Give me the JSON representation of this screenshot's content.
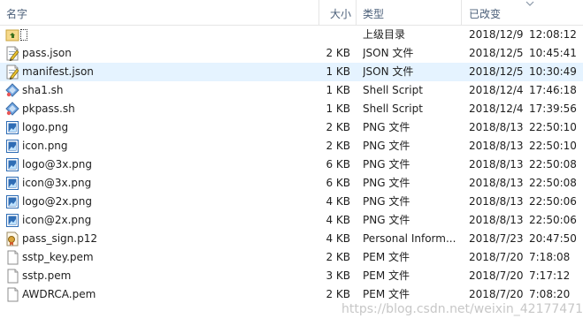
{
  "header": {
    "name_label": "名字",
    "size_label": "大小",
    "type_label": "类型",
    "date_label": "已改变"
  },
  "files": [
    {
      "name": "",
      "size": "",
      "type": "上级目录",
      "date": "2018/12/9",
      "time": "12:08:12",
      "icon": "parent-folder-icon"
    },
    {
      "name": "pass.json",
      "size": "2 KB",
      "type": "JSON 文件",
      "date": "2018/12/5",
      "time": "10:45:41",
      "icon": "json-file-icon"
    },
    {
      "name": "manifest.json",
      "size": "1 KB",
      "type": "JSON 文件",
      "date": "2018/12/5",
      "time": "10:30:49",
      "icon": "json-file-icon"
    },
    {
      "name": "sha1.sh",
      "size": "1 KB",
      "type": "Shell Script",
      "date": "2018/12/4",
      "time": "17:46:18",
      "icon": "shell-script-icon"
    },
    {
      "name": "pkpass.sh",
      "size": "1 KB",
      "type": "Shell Script",
      "date": "2018/12/4",
      "time": "17:39:56",
      "icon": "shell-script-icon"
    },
    {
      "name": "logo.png",
      "size": "2 KB",
      "type": "PNG 文件",
      "date": "2018/8/13",
      "time": "22:50:10",
      "icon": "png-file-icon"
    },
    {
      "name": "icon.png",
      "size": "2 KB",
      "type": "PNG 文件",
      "date": "2018/8/13",
      "time": "22:50:10",
      "icon": "png-file-icon"
    },
    {
      "name": "logo@3x.png",
      "size": "6 KB",
      "type": "PNG 文件",
      "date": "2018/8/13",
      "time": "22:50:08",
      "icon": "png-file-icon"
    },
    {
      "name": "icon@3x.png",
      "size": "6 KB",
      "type": "PNG 文件",
      "date": "2018/8/13",
      "time": "22:50:08",
      "icon": "png-file-icon"
    },
    {
      "name": "logo@2x.png",
      "size": "4 KB",
      "type": "PNG 文件",
      "date": "2018/8/13",
      "time": "22:50:06",
      "icon": "png-file-icon"
    },
    {
      "name": "icon@2x.png",
      "size": "4 KB",
      "type": "PNG 文件",
      "date": "2018/8/13",
      "time": "22:50:06",
      "icon": "png-file-icon"
    },
    {
      "name": "pass_sign.p12",
      "size": "4 KB",
      "type": "Personal Inform...",
      "date": "2018/7/23",
      "time": "20:47:50",
      "icon": "certificate-file-icon"
    },
    {
      "name": "sstp_key.pem",
      "size": "2 KB",
      "type": "PEM 文件",
      "date": "2018/7/20",
      "time": "7:18:08",
      "icon": "blank-file-icon"
    },
    {
      "name": "sstp.pem",
      "size": "3 KB",
      "type": "PEM 文件",
      "date": "2018/7/20",
      "time": "7:17:12",
      "icon": "blank-file-icon"
    },
    {
      "name": "AWDRCA.pem",
      "size": "2 KB",
      "type": "PEM 文件",
      "date": "2018/7/20",
      "time": "7:08:20",
      "icon": "blank-file-icon"
    }
  ],
  "watermark": "https://blog.csdn.net/weixin_42177471",
  "colors": {
    "selection": "#e5f3ff",
    "header_text": "#4c607a"
  }
}
